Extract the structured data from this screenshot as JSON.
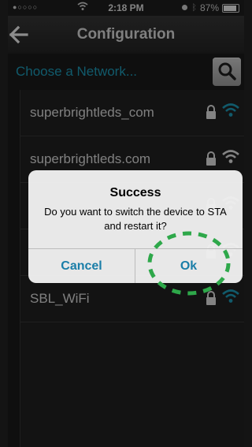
{
  "status_bar": {
    "signal_dots": "●○○○○",
    "time": "2:18 PM",
    "battery_percent": "87%",
    "battery_level": 0.87
  },
  "nav": {
    "title": "Configuration",
    "back_icon": "back-arrow-icon"
  },
  "header": {
    "choose_label": "Choose a Network...",
    "search_icon": "search-icon"
  },
  "networks": [
    {
      "name": "superbrightleds_com",
      "locked": true
    },
    {
      "name": "superbrightleds.com",
      "locked": true
    },
    {
      "name": "",
      "locked": true
    },
    {
      "name": "",
      "locked": true
    },
    {
      "name": "SBL_WiFi",
      "locked": true
    }
  ],
  "alert": {
    "title": "Success",
    "message": "Do you want to switch the device to STA and restart it?",
    "cancel_label": "Cancel",
    "ok_label": "Ok"
  },
  "colors": {
    "accent": "#1fa4c4",
    "button_text": "#1a7ea8",
    "highlight": "#2ea84a"
  }
}
